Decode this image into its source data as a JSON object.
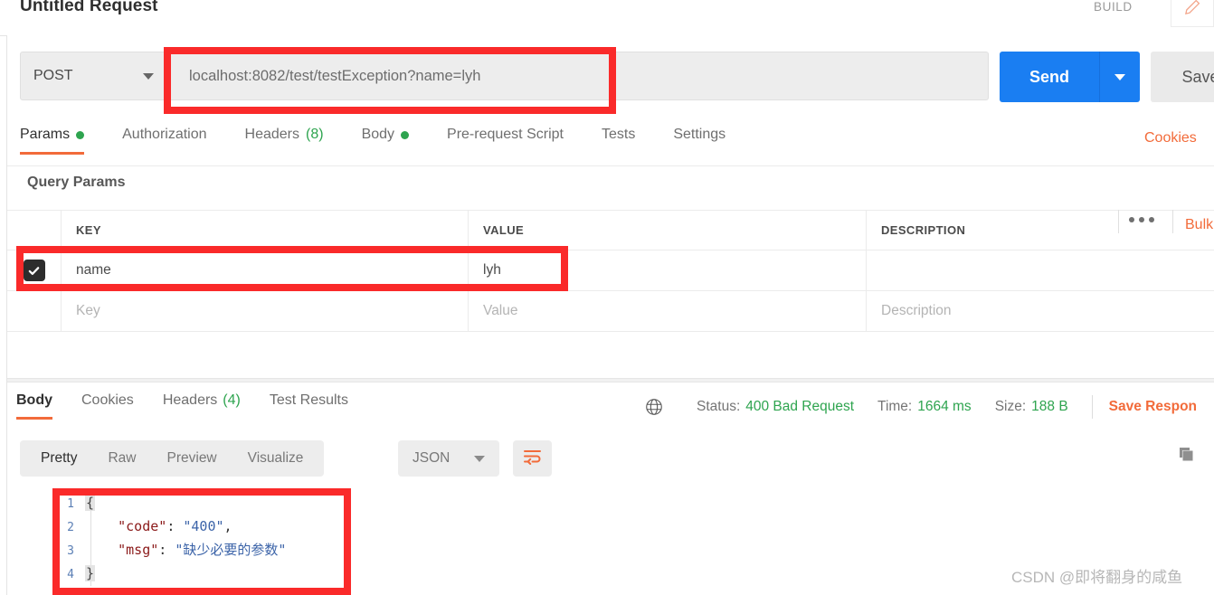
{
  "request": {
    "title": "Untitled Request",
    "build_label": "BUILD",
    "edit_icon": "pencil-icon",
    "method": "POST",
    "url": "localhost:8082/test/testException?name=lyh",
    "send_label": "Send",
    "save_label": "Save",
    "tabs": [
      {
        "label": "Params",
        "indicator": "dot",
        "active": true
      },
      {
        "label": "Authorization",
        "indicator": "",
        "active": false
      },
      {
        "label": "Headers",
        "count": "(8)",
        "indicator": "count",
        "active": false
      },
      {
        "label": "Body",
        "indicator": "dot",
        "active": false
      },
      {
        "label": "Pre-request Script",
        "indicator": "",
        "active": false
      },
      {
        "label": "Tests",
        "indicator": "",
        "active": false
      },
      {
        "label": "Settings",
        "indicator": "",
        "active": false
      }
    ],
    "cookies_link": "Cookies",
    "section_label": "Query Params",
    "bulk_edit_label": "Bulk",
    "more_icon": "ellipsis-icon"
  },
  "params_table": {
    "headers": [
      "KEY",
      "VALUE",
      "DESCRIPTION"
    ],
    "rows": [
      {
        "checked": true,
        "key": "name",
        "value": "lyh",
        "description": ""
      }
    ],
    "placeholder_row": {
      "key": "Key",
      "value": "Value",
      "description": "Description"
    }
  },
  "response": {
    "tabs": [
      {
        "label": "Body",
        "active": true
      },
      {
        "label": "Cookies",
        "active": false
      },
      {
        "label": "Headers",
        "count": "(4)",
        "active": false
      },
      {
        "label": "Test Results",
        "active": false
      }
    ],
    "globe_icon": "globe-icon",
    "status_label": "Status:",
    "status_value": "400 Bad Request",
    "time_label": "Time:",
    "time_value": "1664 ms",
    "size_label": "Size:",
    "size_value": "188 B",
    "save_response_label": "Save Respon",
    "format_tabs": [
      {
        "label": "Pretty",
        "active": true
      },
      {
        "label": "Raw",
        "active": false
      },
      {
        "label": "Preview",
        "active": false
      },
      {
        "label": "Visualize",
        "active": false
      }
    ],
    "language": "JSON",
    "wrap_icon": "word-wrap-icon",
    "copy_icon": "copy-icon",
    "body_lines": [
      {
        "no": "1",
        "brace": "{",
        "key": "",
        "punc": "",
        "str": "",
        "tail": ""
      },
      {
        "no": "2",
        "brace": "",
        "key": "\"code\"",
        "punc": ": ",
        "str": "\"400\"",
        "tail": ","
      },
      {
        "no": "3",
        "brace": "",
        "key": "\"msg\"",
        "punc": ": ",
        "str": "\"缺少必要的参数\"",
        "tail": ""
      },
      {
        "no": "4",
        "brace": "}",
        "key": "",
        "punc": "",
        "str": "",
        "tail": ""
      }
    ]
  },
  "colors": {
    "accent_orange": "#f26b3a",
    "send_blue": "#1a7ef2",
    "status_green": "#2ea44f",
    "annotation_red": "#fa2a2a"
  },
  "watermark": "CSDN @即将翻身的咸鱼"
}
